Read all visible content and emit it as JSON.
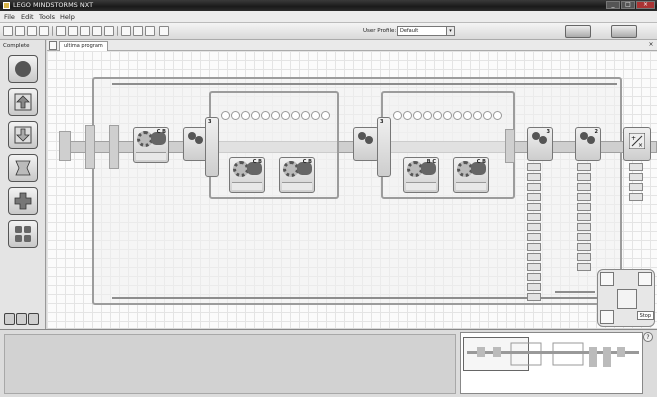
{
  "window": {
    "title": "LEGO MINDSTORMS NXT",
    "controls": [
      "minimize",
      "maximize",
      "close"
    ]
  },
  "menu": {
    "items": [
      "File",
      "Edit",
      "Tools",
      "Help"
    ]
  },
  "toolbar": {
    "buttons": [
      "new-icon",
      "open-icon",
      "save-icon",
      "print-icon",
      "cut-icon",
      "copy-icon",
      "undo-icon",
      "redo-icon",
      "pointer-icon",
      "pan-icon",
      "comment-icon",
      "custom-palette-icon"
    ],
    "user_profile_label": "User Profile:",
    "user_profile_value": "Default"
  },
  "palette": {
    "tab_label": "Complete",
    "items": [
      "common-icon",
      "action-icon",
      "sensor-icon",
      "flow-icon",
      "data-icon",
      "advanced-icon"
    ],
    "bottom_tabs": [
      "common-palette-tab",
      "complete-palette-tab",
      "custom-palette-tab"
    ]
  },
  "document": {
    "tab_label": "ultima program"
  },
  "program": {
    "motor_blocks": [
      {
        "port": "C B"
      },
      {
        "port": "C B"
      },
      {
        "port": "C B"
      },
      {
        "port": "B C"
      },
      {
        "port": "C B"
      }
    ],
    "sensor_blocks": [
      {
        "num": "3"
      },
      {
        "num": "3"
      },
      {
        "num": "2"
      },
      {
        "num": "3"
      }
    ],
    "switch_numbers": [
      "3",
      "3"
    ]
  },
  "controller": {
    "stop_label": "Stop"
  },
  "help": {
    "question_mark": "?"
  },
  "colors": {
    "title_bar": "#1a1a1a",
    "canvas": "#fbfbfb",
    "beam": "#cfcfcf",
    "wire": "#8d8d8d"
  }
}
